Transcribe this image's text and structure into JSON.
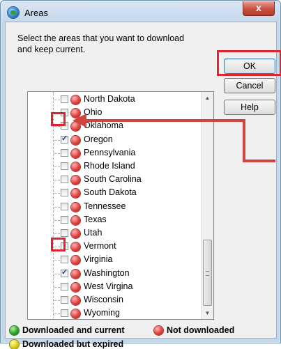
{
  "window": {
    "title": "Areas",
    "close_glyph": "x"
  },
  "instruction": "Select the areas that you want to download and keep current.",
  "buttons": {
    "ok": "OK",
    "cancel": "Cancel",
    "help": "Help"
  },
  "tree": {
    "items": [
      {
        "label": "North Dakota",
        "checked": false,
        "status": "not-downloaded"
      },
      {
        "label": "Ohio",
        "checked": false,
        "status": "not-downloaded"
      },
      {
        "label": "Oklahoma",
        "checked": false,
        "status": "not-downloaded"
      },
      {
        "label": "Oregon",
        "checked": true,
        "status": "not-downloaded"
      },
      {
        "label": "Pennsylvania",
        "checked": false,
        "status": "not-downloaded"
      },
      {
        "label": "Rhode Island",
        "checked": false,
        "status": "not-downloaded"
      },
      {
        "label": "South Carolina",
        "checked": false,
        "status": "not-downloaded"
      },
      {
        "label": "South Dakota",
        "checked": false,
        "status": "not-downloaded"
      },
      {
        "label": "Tennessee",
        "checked": false,
        "status": "not-downloaded"
      },
      {
        "label": "Texas",
        "checked": false,
        "status": "not-downloaded"
      },
      {
        "label": "Utah",
        "checked": false,
        "status": "not-downloaded"
      },
      {
        "label": "Vermont",
        "checked": false,
        "status": "not-downloaded"
      },
      {
        "label": "Virginia",
        "checked": false,
        "status": "not-downloaded"
      },
      {
        "label": "Washington",
        "checked": true,
        "status": "not-downloaded"
      },
      {
        "label": "West Virgina",
        "checked": false,
        "status": "not-downloaded"
      },
      {
        "label": "Wisconsin",
        "checked": false,
        "status": "not-downloaded"
      },
      {
        "label": "Wyoming",
        "checked": false,
        "status": "not-downloaded"
      }
    ]
  },
  "legend": {
    "current": "Downloaded and current",
    "not_downloaded": "Not downloaded",
    "expired": "Downloaded but expired"
  },
  "colors": {
    "highlight": "#e0232d",
    "status_current": "#2aa42a",
    "status_not_downloaded": "#e0433d",
    "status_expired": "#d9cf10"
  },
  "icons": {
    "app": "globe-icon",
    "close": "close-icon",
    "scroll_up": "scroll-up-arrow-icon",
    "scroll_down": "scroll-down-arrow-icon"
  }
}
